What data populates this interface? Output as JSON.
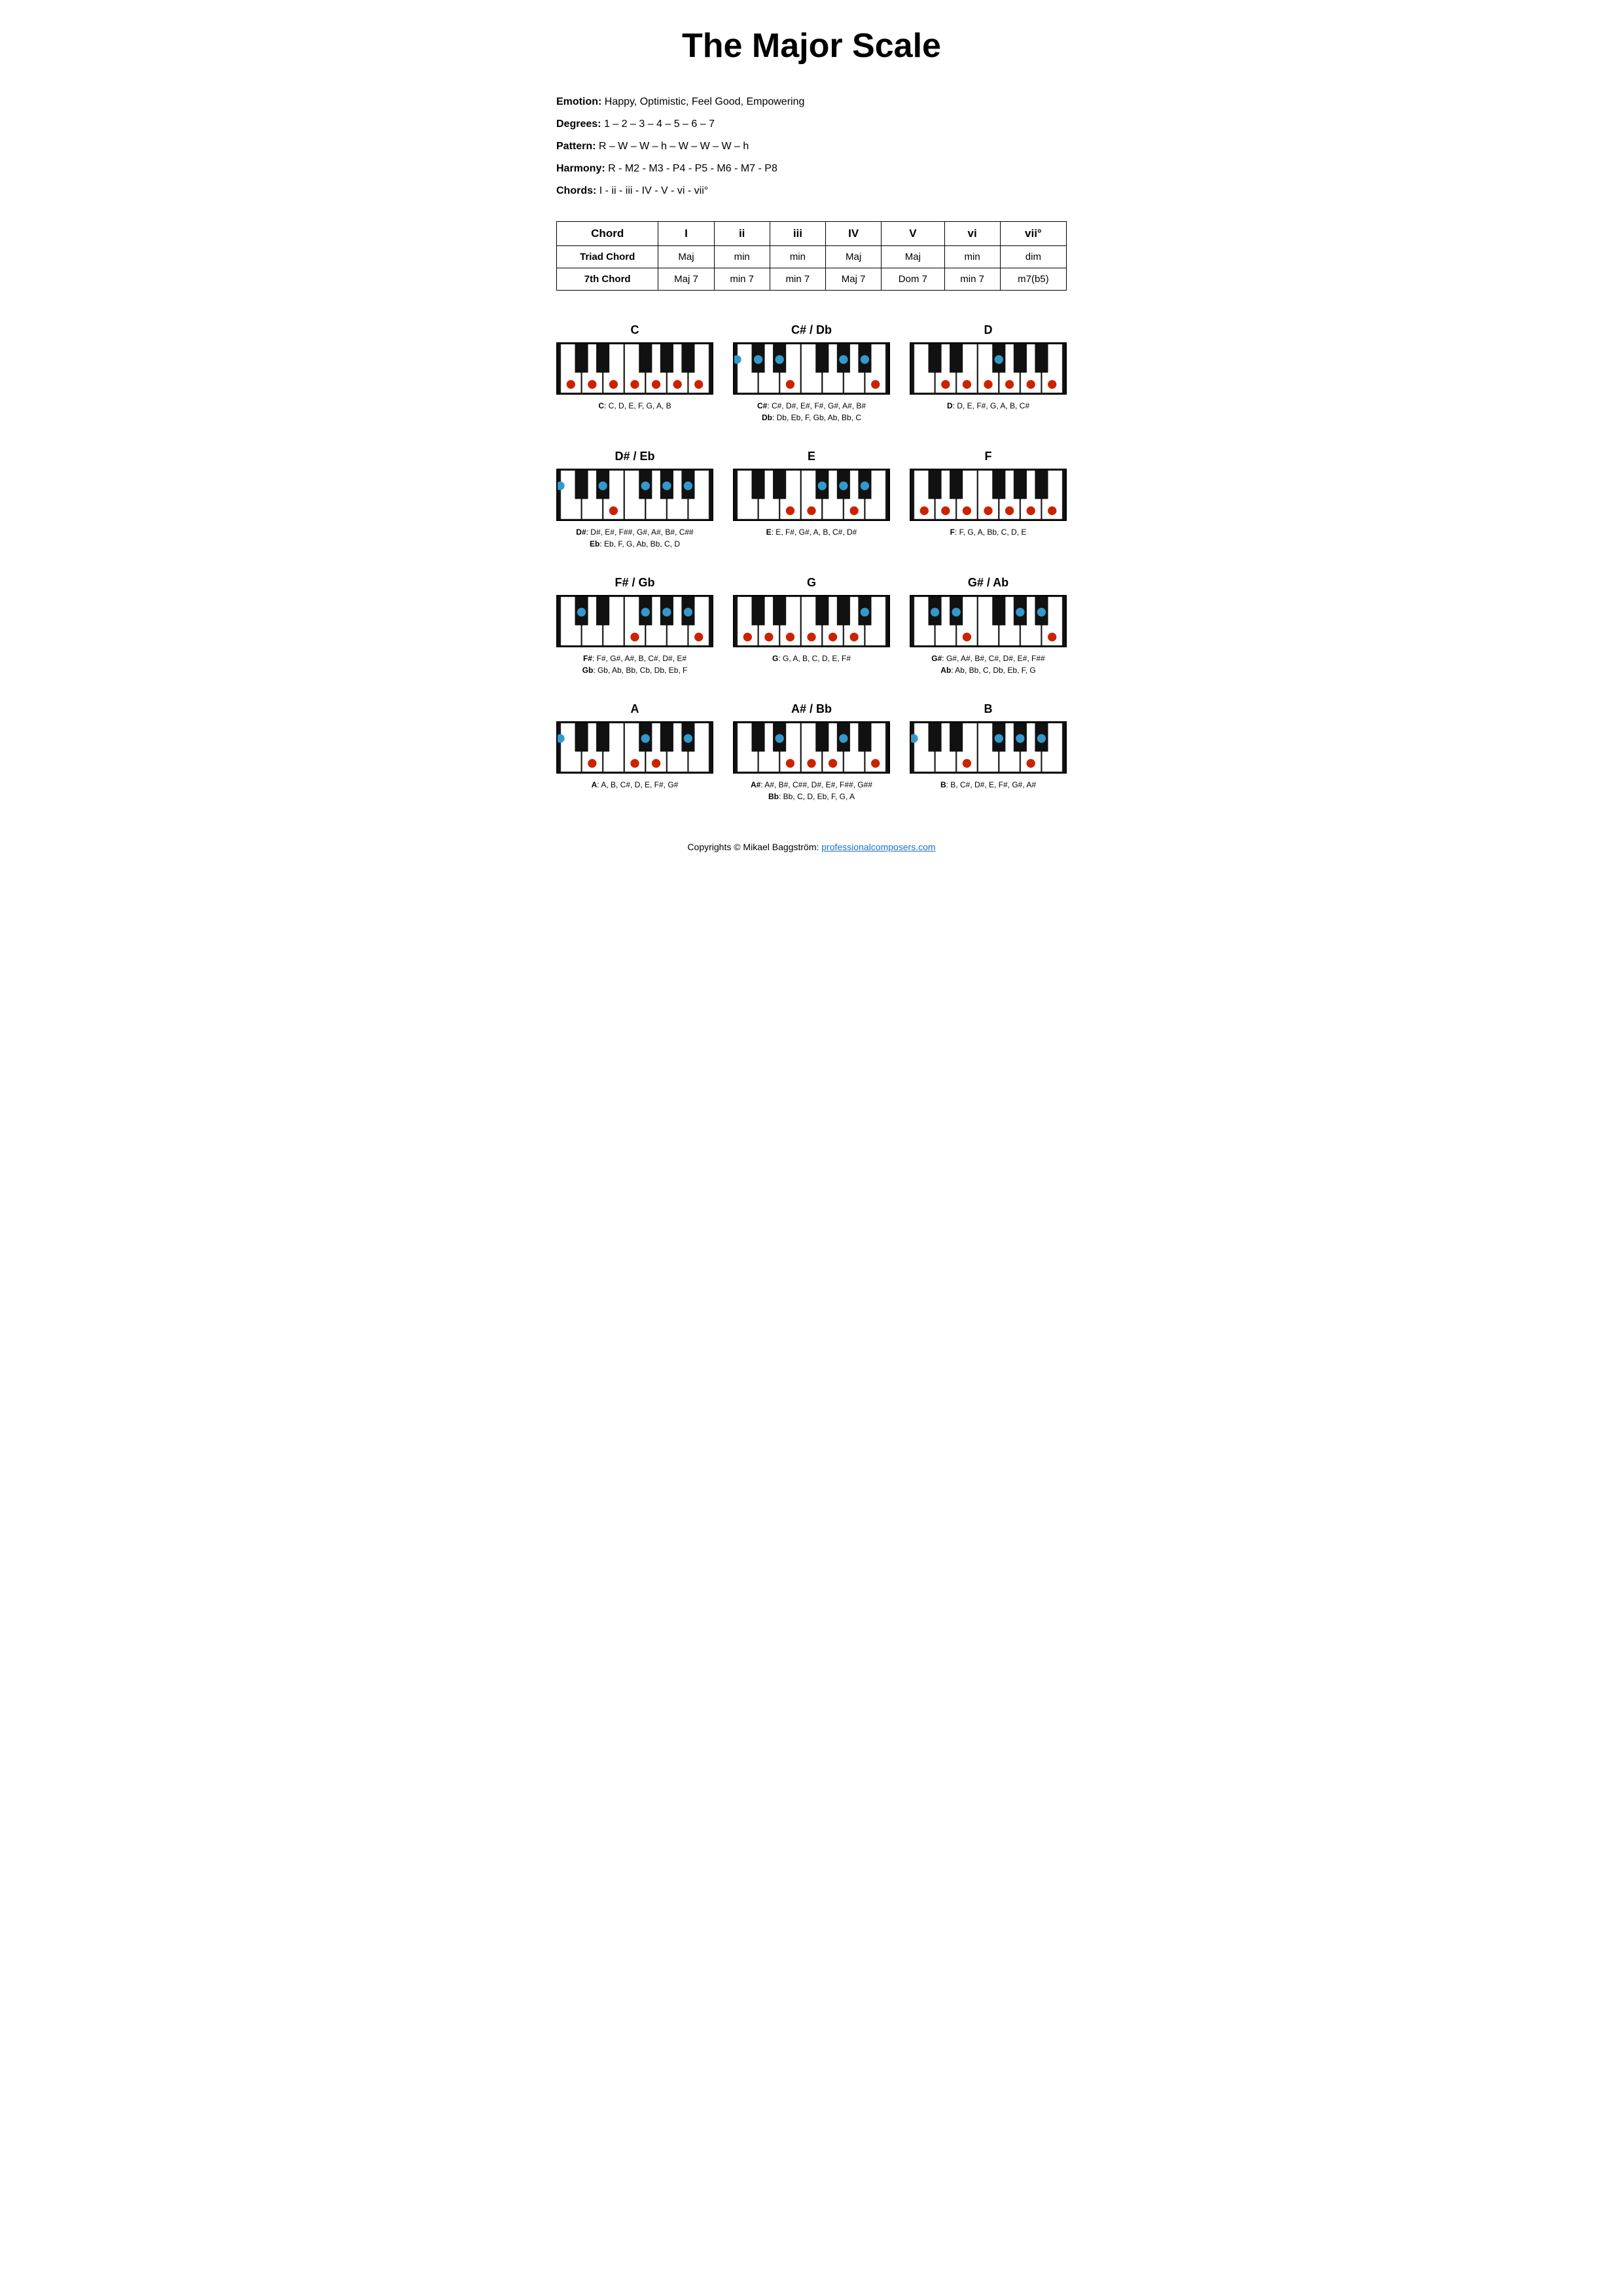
{
  "title": "The Major Scale",
  "info": {
    "emotion_label": "Emotion:",
    "emotion_value": "Happy, Optimistic, Feel Good, Empowering",
    "degrees_label": "Degrees:",
    "degrees_value": "1 – 2 – 3 – 4 – 5 – 6 – 7",
    "pattern_label": "Pattern:",
    "pattern_value": "R – W – W – h – W – W – W – h",
    "harmony_label": "Harmony:",
    "harmony_value": "R - M2 - M3 - P4 - P5 - M6 - M7 - P8",
    "chords_label": "Chords:",
    "chords_value": "I - ii - iii - IV - V - vi - vii°"
  },
  "table": {
    "headers": [
      "Chord",
      "I",
      "ii",
      "iii",
      "IV",
      "V",
      "vi",
      "vii°"
    ],
    "rows": [
      [
        "Triad Chord",
        "Maj",
        "min",
        "min",
        "Maj",
        "Maj",
        "min",
        "dim"
      ],
      [
        "7th Chord",
        "Maj 7",
        "min 7",
        "min 7",
        "Maj 7",
        "Dom 7",
        "min 7",
        "m7(b5)"
      ]
    ]
  },
  "pianos": [
    {
      "title": "C",
      "notes_label": "C: C, D, E, F, G, A, B",
      "notes_label2": "",
      "white_dots": [
        0,
        1,
        2,
        3,
        4,
        5,
        6
      ],
      "black_dots": []
    },
    {
      "title": "C# / Db",
      "notes_label": "C#: C#, D#, E#, F#, G#, A#, B#",
      "notes_label2": "Db: Db, Eb, F, Gb, Ab, Bb, C",
      "white_dots": [
        2,
        6
      ],
      "black_dots": [
        0,
        1,
        3,
        4,
        5
      ]
    },
    {
      "title": "D",
      "notes_label": "D: D, E, F#, G, A, B, C#",
      "notes_label2": "",
      "white_dots": [
        1,
        2,
        3,
        4,
        5,
        6
      ],
      "black_dots": [
        2
      ]
    },
    {
      "title": "D# / Eb",
      "notes_label": "D#: D#, E#, F##, G#, A#, B#, C##",
      "notes_label2": "Eb: Eb, F, G, Ab, Bb, C, D",
      "white_dots": [
        2
      ],
      "black_dots": [
        1,
        2,
        3,
        4,
        5
      ]
    },
    {
      "title": "E",
      "notes_label": "E: E, F#, G#, A, B, C#, D#",
      "notes_label2": "",
      "white_dots": [
        2,
        3,
        5
      ],
      "black_dots": [
        2,
        3,
        4
      ]
    },
    {
      "title": "F",
      "notes_label": "F: F, G, A, Bb, C, D, E",
      "notes_label2": "",
      "white_dots": [
        0,
        1,
        2,
        3,
        4,
        5,
        6
      ],
      "black_dots": []
    },
    {
      "title": "F# / Gb",
      "notes_label": "F#: F#, G#, A#, B, C#, D#, E#",
      "notes_label2": "Gb: Gb, Ab, Bb, Cb, Db, Eb, F",
      "white_dots": [
        3,
        6
      ],
      "black_dots": [
        0,
        2,
        3,
        4
      ]
    },
    {
      "title": "G",
      "notes_label": "G: G, A, B, C, D, E, F#",
      "notes_label2": "",
      "white_dots": [
        0,
        1,
        2,
        3,
        4,
        5
      ],
      "black_dots": [
        4
      ]
    },
    {
      "title": "G# / Ab",
      "notes_label": "G#: G#, A#, B#, C#, D#, E#, F##",
      "notes_label2": "Ab: Ab, Bb, C, Db, Eb, F, G",
      "white_dots": [
        2,
        6
      ],
      "black_dots": [
        0,
        1,
        3,
        4
      ]
    },
    {
      "title": "A",
      "notes_label": "A: A, B, C#, D, E, F#, G#",
      "notes_label2": "",
      "white_dots": [
        1,
        3,
        4
      ],
      "black_dots": [
        2,
        4,
        5
      ]
    },
    {
      "title": "A# / Bb",
      "notes_label": "A#: A#, B#, C##, D#, E#, F##, G##",
      "notes_label2": "Bb: Bb, C, D, Eb, F, G, A",
      "white_dots": [
        2,
        3,
        4,
        6
      ],
      "black_dots": [
        1,
        3
      ]
    },
    {
      "title": "B",
      "notes_label": "B: B, C#, D#, E, F#, G#, A#",
      "notes_label2": "",
      "white_dots": [
        2,
        5
      ],
      "black_dots": [
        2,
        3,
        4,
        5
      ]
    }
  ],
  "copyright": "Copyrights © Mikael Baggström: ",
  "copyright_link_text": "professionalcomposers.com",
  "copyright_link": "https://professionalcomposers.com"
}
